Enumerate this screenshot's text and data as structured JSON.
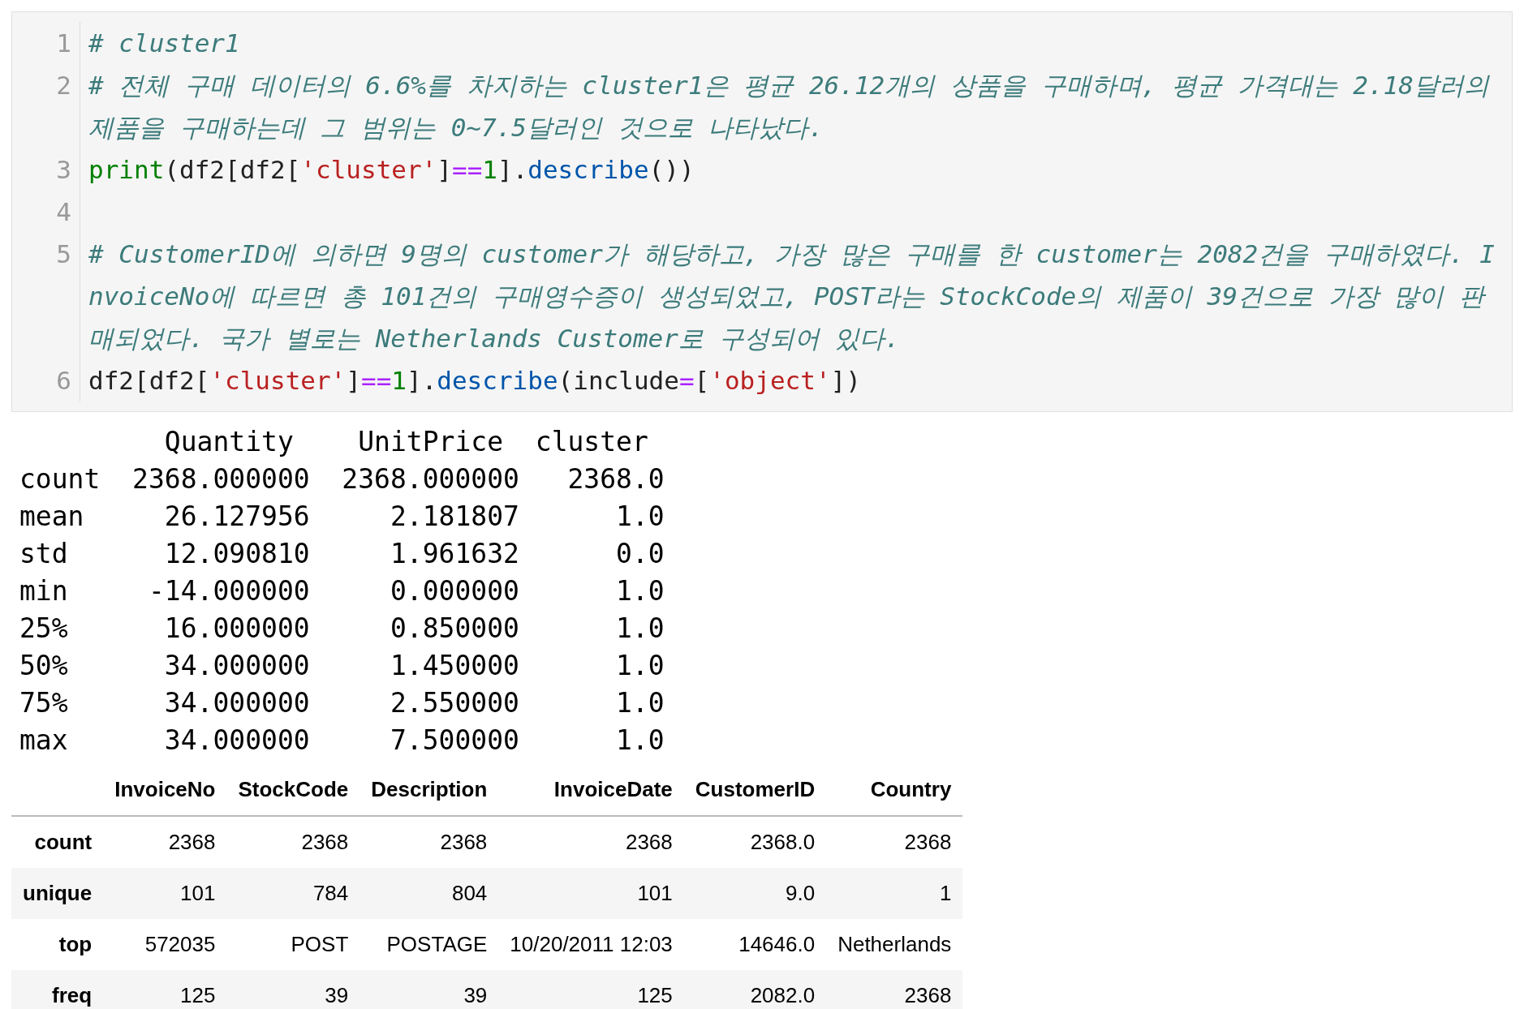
{
  "code_cell": {
    "lines": [
      {
        "number": "1",
        "tokens": [
          {
            "kind": "comment",
            "text": "# cluster1"
          }
        ]
      },
      {
        "number": "2",
        "tokens": [
          {
            "kind": "comment",
            "text": "# 전체 구매 데이터의 6.6%를 차지하는 cluster1은 평균 26.12개의 상품을 구매하며, 평균 가격대는 2.18달러의 제품을 구매하는데 그 범위는 0~7.5달러인 것으로 나타났다."
          }
        ]
      },
      {
        "number": "3",
        "tokens": [
          {
            "kind": "builtin",
            "text": "print"
          },
          {
            "kind": "plain",
            "text": "(df2[df2["
          },
          {
            "kind": "string",
            "text": "'cluster'"
          },
          {
            "kind": "plain",
            "text": "]"
          },
          {
            "kind": "operator",
            "text": "=="
          },
          {
            "kind": "number",
            "text": "1"
          },
          {
            "kind": "plain",
            "text": "]."
          },
          {
            "kind": "method",
            "text": "describe"
          },
          {
            "kind": "plain",
            "text": "())"
          }
        ]
      },
      {
        "number": "4"
      },
      {
        "number": "5",
        "tokens": [
          {
            "kind": "comment",
            "text": "# CustomerID에 의하면 9명의 customer가 해당하고, 가장 많은 구매를 한 customer는 2082건을 구매하였다. InvoiceNo에 따르면 총 101건의 구매영수증이 생성되었고, POST라는 StockCode의 제품이 39건으로 가장 많이 판매되었다. 국가 별로는 Netherlands Customer로 구성되어 있다."
          }
        ]
      },
      {
        "number": "6",
        "tokens": [
          {
            "kind": "plain",
            "text": "df2[df2["
          },
          {
            "kind": "string",
            "text": "'cluster'"
          },
          {
            "kind": "plain",
            "text": "]"
          },
          {
            "kind": "operator",
            "text": "=="
          },
          {
            "kind": "number",
            "text": "1"
          },
          {
            "kind": "plain",
            "text": "]."
          },
          {
            "kind": "method",
            "text": "describe"
          },
          {
            "kind": "plain",
            "text": "(include"
          },
          {
            "kind": "operator",
            "text": "="
          },
          {
            "kind": "plain",
            "text": "["
          },
          {
            "kind": "string",
            "text": "'object'"
          },
          {
            "kind": "plain",
            "text": "])"
          }
        ]
      }
    ]
  },
  "print_output": {
    "lines": [
      "         Quantity    UnitPrice  cluster",
      "count  2368.000000  2368.000000   2368.0",
      "mean     26.127956     2.181807      1.0",
      "std      12.090810     1.961632      0.0",
      "min     -14.000000     0.000000      1.0",
      "25%      16.000000     0.850000      1.0",
      "50%      34.000000     1.450000      1.0",
      "75%      34.000000     2.550000      1.0",
      "max      34.000000     7.500000      1.0"
    ]
  },
  "dataframe": {
    "columns": [
      "InvoiceNo",
      "StockCode",
      "Description",
      "InvoiceDate",
      "CustomerID",
      "Country"
    ],
    "rows": [
      {
        "index": "count",
        "cells": [
          "2368",
          "2368",
          "2368",
          "2368",
          "2368.0",
          "2368"
        ]
      },
      {
        "index": "unique",
        "cells": [
          "101",
          "784",
          "804",
          "101",
          "9.0",
          "1"
        ]
      },
      {
        "index": "top",
        "cells": [
          "572035",
          "POST",
          "POSTAGE",
          "10/20/2011 12:03",
          "14646.0",
          "Netherlands"
        ]
      },
      {
        "index": "freq",
        "cells": [
          "125",
          "39",
          "39",
          "125",
          "2082.0",
          "2368"
        ]
      }
    ]
  }
}
